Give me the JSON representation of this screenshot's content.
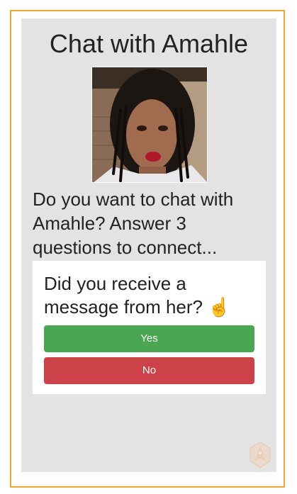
{
  "page": {
    "title": "Chat with Amahle"
  },
  "profile": {
    "image_name": "profile-photo"
  },
  "prompt": {
    "text": "Do you want to chat with Amahle? Answer 3 questions to connect..."
  },
  "question_card": {
    "question": "Did you receive a message from her?",
    "emoji": "☝️",
    "yes_label": "Yes",
    "no_label": "No"
  },
  "colors": {
    "frame_border": "#f0a830",
    "panel_background": "#e3e3e3",
    "yes_button": "#4aa650",
    "no_button": "#cd4148"
  },
  "icons": {
    "watermark": "rocket-icon"
  }
}
